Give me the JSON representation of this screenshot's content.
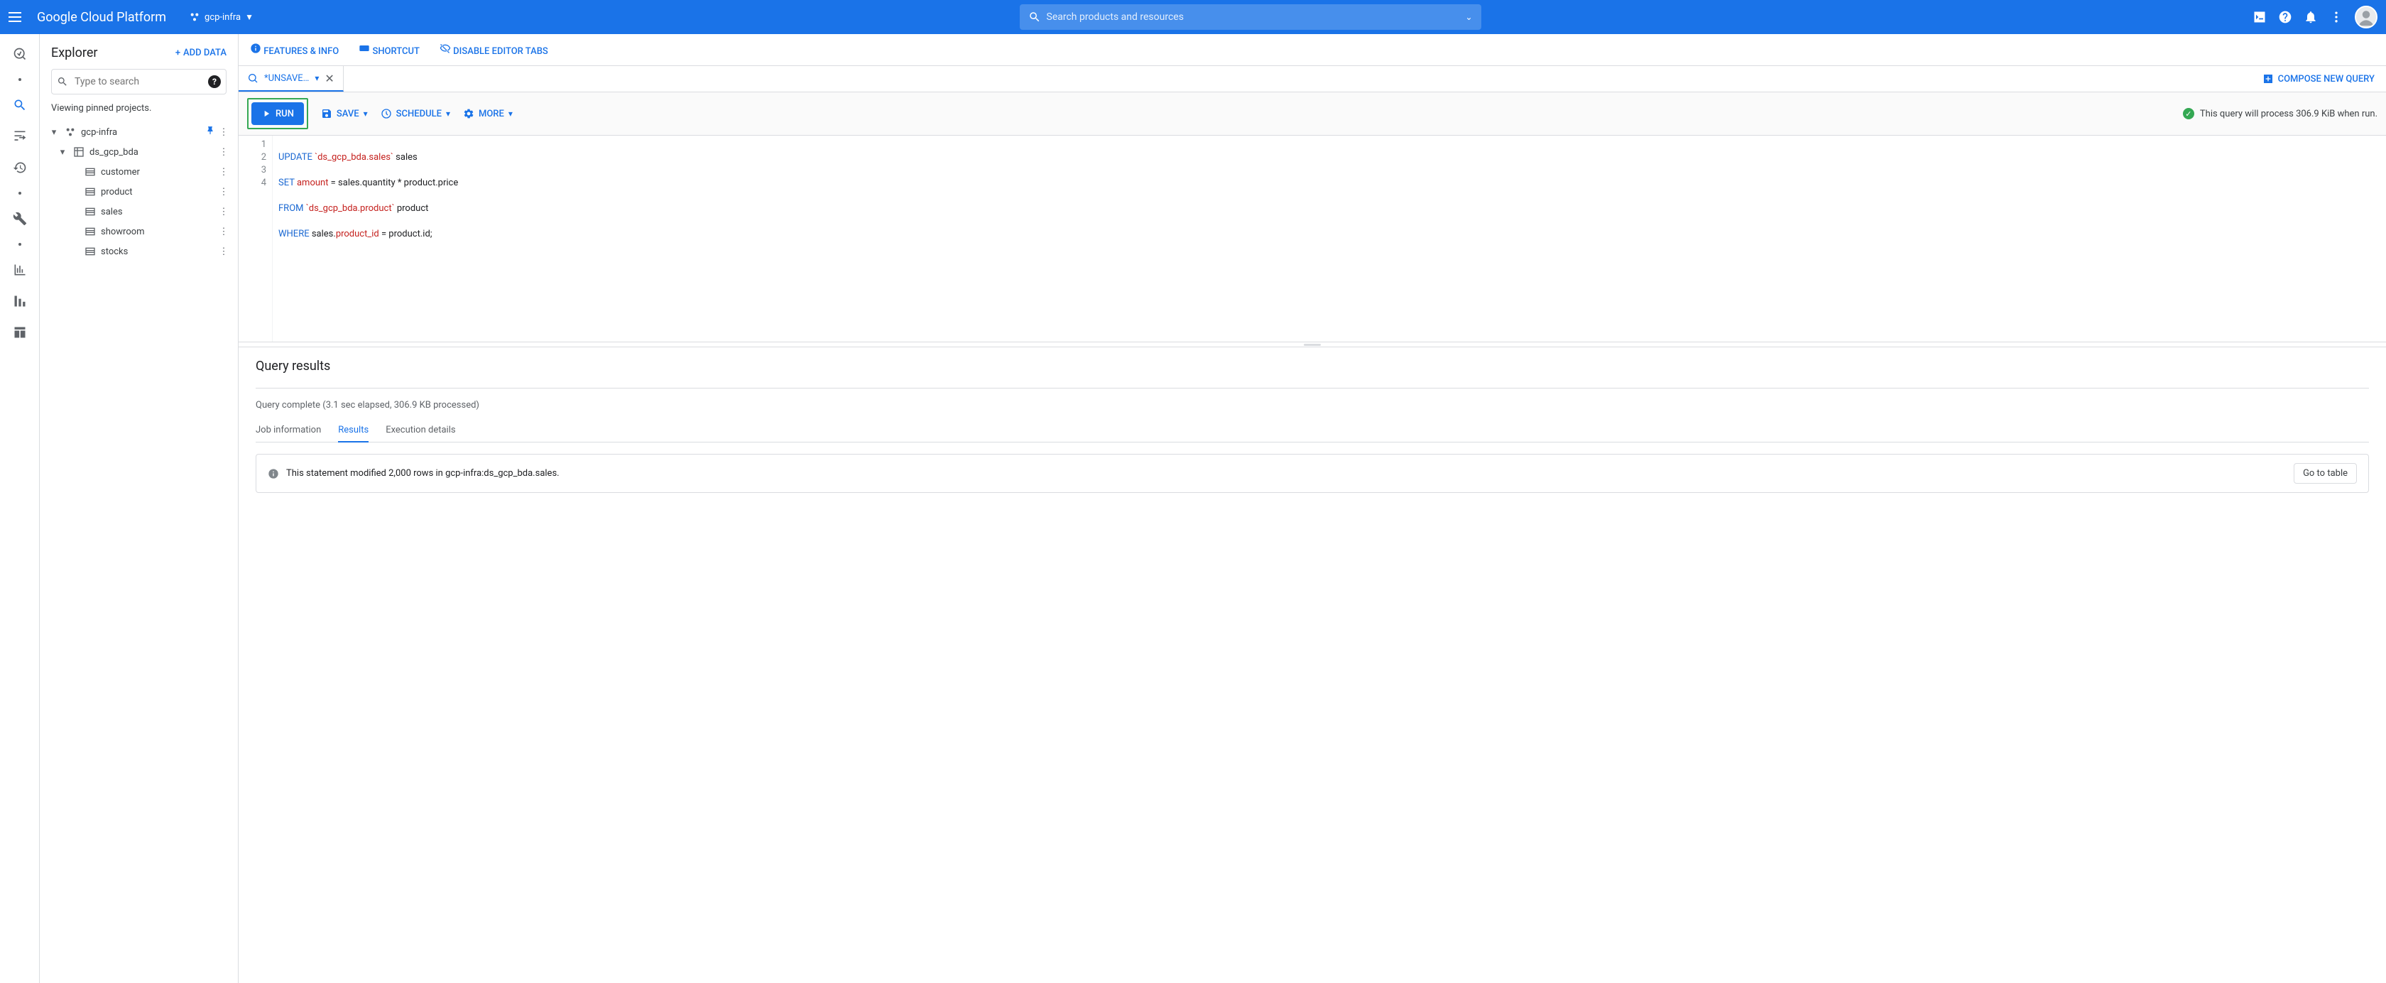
{
  "topbar": {
    "title": "Google Cloud Platform",
    "project": "gcp-infra",
    "search_placeholder": "Search products and resources"
  },
  "feature_bar": {
    "features": "FEATURES & INFO",
    "shortcut": "SHORTCUT",
    "disable_tabs": "DISABLE EDITOR TABS"
  },
  "explorer": {
    "title": "Explorer",
    "add_data": "ADD DATA",
    "search_placeholder": "Type to search",
    "pinned_msg": "Viewing pinned projects.",
    "tree": {
      "project": "gcp-infra",
      "dataset": "ds_gcp_bda",
      "tables": [
        "customer",
        "product",
        "sales",
        "showroom",
        "stocks"
      ]
    }
  },
  "tabs": {
    "tab1": "*UNSAVE…",
    "compose": "COMPOSE NEW QUERY"
  },
  "toolbar": {
    "run": "RUN",
    "save": "SAVE",
    "schedule": "SCHEDULE",
    "more": "MORE",
    "status": "This query will process 306.9 KiB when run."
  },
  "editor": {
    "lines": [
      {
        "n": "1",
        "pre": "UPDATE ",
        "str": "`ds_gcp_bda.sales`",
        "post": " sales"
      },
      {
        "n": "2",
        "pre": "SET ",
        "id": "amount",
        "post": " = sales.quantity * product.price"
      },
      {
        "n": "3",
        "pre": "FROM ",
        "str": "`ds_gcp_bda.product`",
        "post": " product"
      },
      {
        "n": "4",
        "pre": "WHERE ",
        "mid": "sales.",
        "id": "product_id",
        "post": " = product.id;"
      }
    ]
  },
  "results": {
    "title": "Query results",
    "complete": "Query complete (3.1 sec elapsed, 306.9 KB processed)",
    "tabs": {
      "job": "Job information",
      "results": "Results",
      "exec": "Execution details"
    },
    "info": "This statement modified 2,000 rows in gcp-infra:ds_gcp_bda.sales.",
    "goto": "Go to table"
  }
}
